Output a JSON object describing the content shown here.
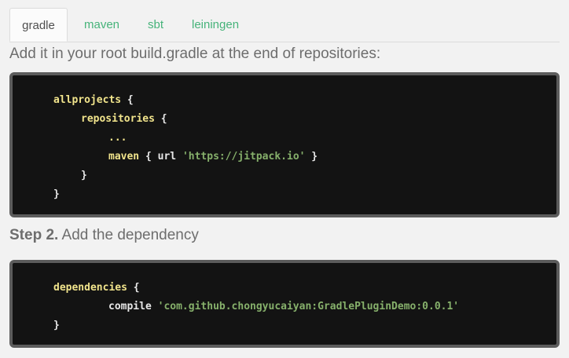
{
  "tabs": [
    {
      "label": "gradle",
      "active": true
    },
    {
      "label": "maven",
      "active": false
    },
    {
      "label": "sbt",
      "active": false
    },
    {
      "label": "leiningen",
      "active": false
    }
  ],
  "intro_text": "Add it in your root build.gradle at the end of repositories:",
  "code1": {
    "allprojects": "allprojects",
    "open_brace_1": " {",
    "repositories": "repositories",
    "open_brace_2": " {",
    "ellipsis": "...",
    "maven": "maven",
    "maven_open": " { ",
    "url_kw": "url",
    "url_value": "'https://jitpack.io'",
    "maven_close": " }",
    "close_inner": "}",
    "close_outer": "}"
  },
  "step2": {
    "label": "Step 2.",
    "text": " Add the dependency"
  },
  "code2": {
    "dependencies": "dependencies",
    "open_brace": " {",
    "compile_kw": "compile",
    "compile_value": "'com.github.chongyucaiyan:GradlePluginDemo:0.0.1'",
    "close": "}"
  },
  "colors": {
    "tab_link": "#46b37a",
    "code_bg": "#131313",
    "code_border": "#5c5c5c",
    "keyword": "#f1e48c",
    "string": "#86b06b"
  }
}
